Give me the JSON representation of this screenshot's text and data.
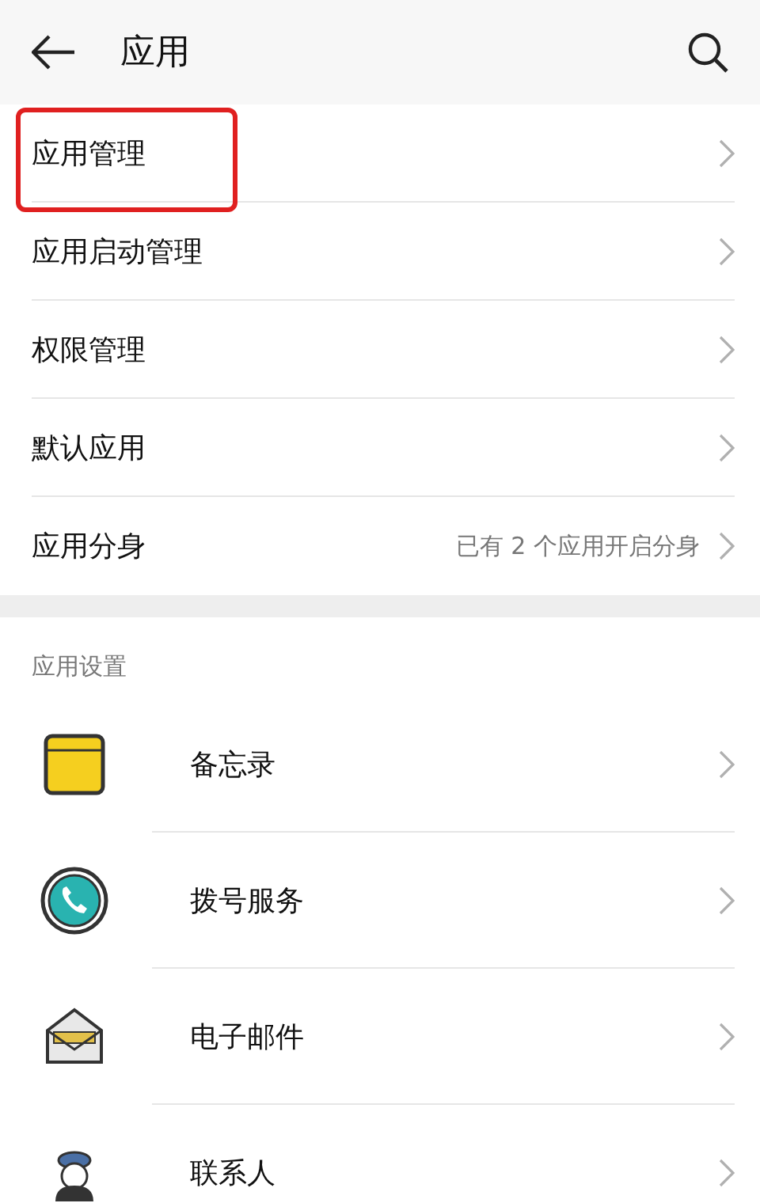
{
  "header": {
    "title": "应用"
  },
  "items": [
    {
      "label": "应用管理",
      "highlighted": true
    },
    {
      "label": "应用启动管理",
      "highlighted": false
    },
    {
      "label": "权限管理",
      "highlighted": false
    },
    {
      "label": "默认应用",
      "highlighted": false
    },
    {
      "label": "应用分身",
      "highlighted": false,
      "value": "已有 2 个应用开启分身"
    }
  ],
  "section": {
    "title": "应用设置"
  },
  "apps": [
    {
      "label": "备忘录",
      "kind": "notes"
    },
    {
      "label": "拨号服务",
      "kind": "phone"
    },
    {
      "label": "电子邮件",
      "kind": "mail"
    },
    {
      "label": "联系人",
      "kind": "contacts"
    }
  ]
}
